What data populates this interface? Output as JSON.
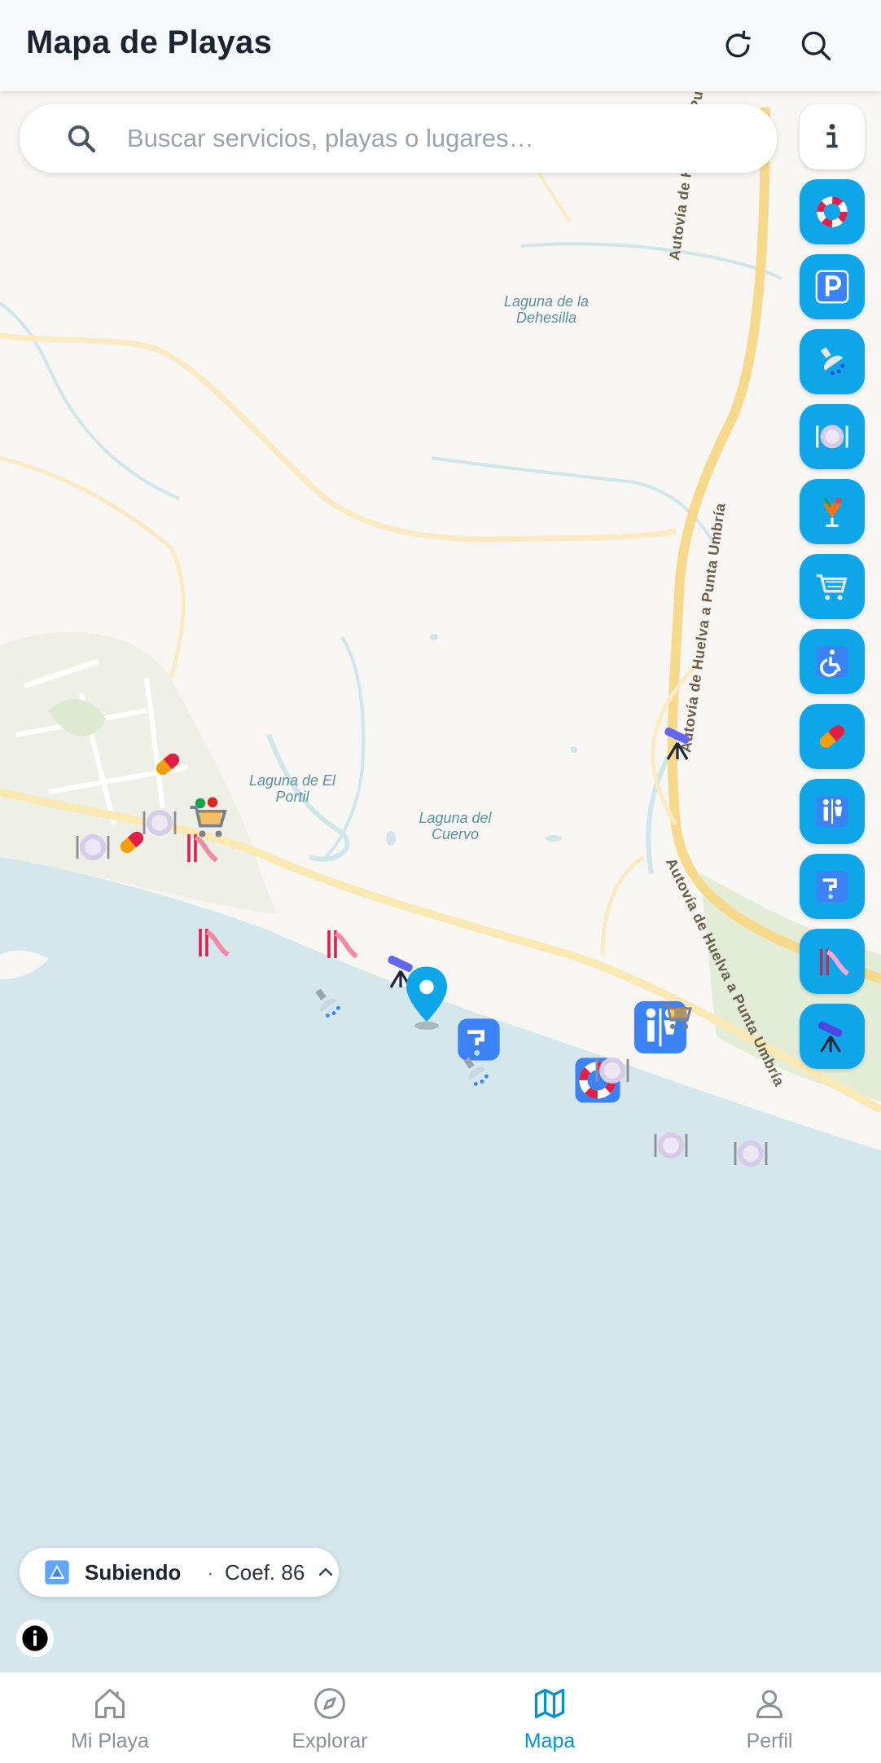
{
  "header": {
    "title": "Mapa de Playas"
  },
  "search": {
    "placeholder": "Buscar servicios, playas o lugares…"
  },
  "map": {
    "labels": [
      {
        "name": "laguna-dehesilla",
        "text_lines": [
          "Laguna de la",
          "Dehesilla"
        ]
      },
      {
        "name": "laguna-el-portil",
        "text_lines": [
          "Laguna de El",
          "Portil"
        ]
      },
      {
        "name": "laguna-cuervo",
        "text_lines": [
          "Laguna del",
          "Cuervo"
        ]
      }
    ],
    "roads": [
      {
        "name": "autovia-top",
        "text": "Autovía de Huelva a Punta"
      },
      {
        "name": "autovia-middle",
        "text": "Autovía de Huelva a Punta Umbría"
      },
      {
        "name": "autovia-bottom",
        "text": "Autovía de Huelva a Punta Umbría"
      }
    ],
    "colors": {
      "land": "#f8f6f2",
      "sea": "#d4e7ec",
      "lagoon": "#cfe6ea",
      "road": "#f6d98a",
      "urban": "#eef0e8",
      "green": "#e3ecd6"
    }
  },
  "filters": [
    {
      "name": "info",
      "icon": "info-icon"
    },
    {
      "name": "lifeguard",
      "icon": "lifebuoy-icon"
    },
    {
      "name": "parking",
      "icon": "parking-icon"
    },
    {
      "name": "showers",
      "icon": "shower-icon"
    },
    {
      "name": "restaurants",
      "icon": "plate-icon"
    },
    {
      "name": "beach-bars",
      "icon": "cocktail-icon"
    },
    {
      "name": "shops",
      "icon": "shopping-cart-icon"
    },
    {
      "name": "accessibility",
      "icon": "wheelchair-icon"
    },
    {
      "name": "pharmacy",
      "icon": "pill-icon"
    },
    {
      "name": "toilets",
      "icon": "restroom-icon"
    },
    {
      "name": "water",
      "icon": "water-tap-icon"
    },
    {
      "name": "playground",
      "icon": "slide-icon"
    },
    {
      "name": "viewpoint",
      "icon": "telescope-icon"
    }
  ],
  "tide": {
    "status": "Subiendo",
    "separator": "·",
    "coef": "Coef. 86"
  },
  "nav": [
    {
      "name": "mi-playa",
      "label": "Mi Playa",
      "icon": "home-icon",
      "active": false
    },
    {
      "name": "explorar",
      "label": "Explorar",
      "icon": "compass-icon",
      "active": false
    },
    {
      "name": "mapa",
      "label": "Mapa",
      "icon": "map-icon",
      "active": true
    },
    {
      "name": "perfil",
      "label": "Perfil",
      "icon": "user-icon",
      "active": false
    }
  ]
}
